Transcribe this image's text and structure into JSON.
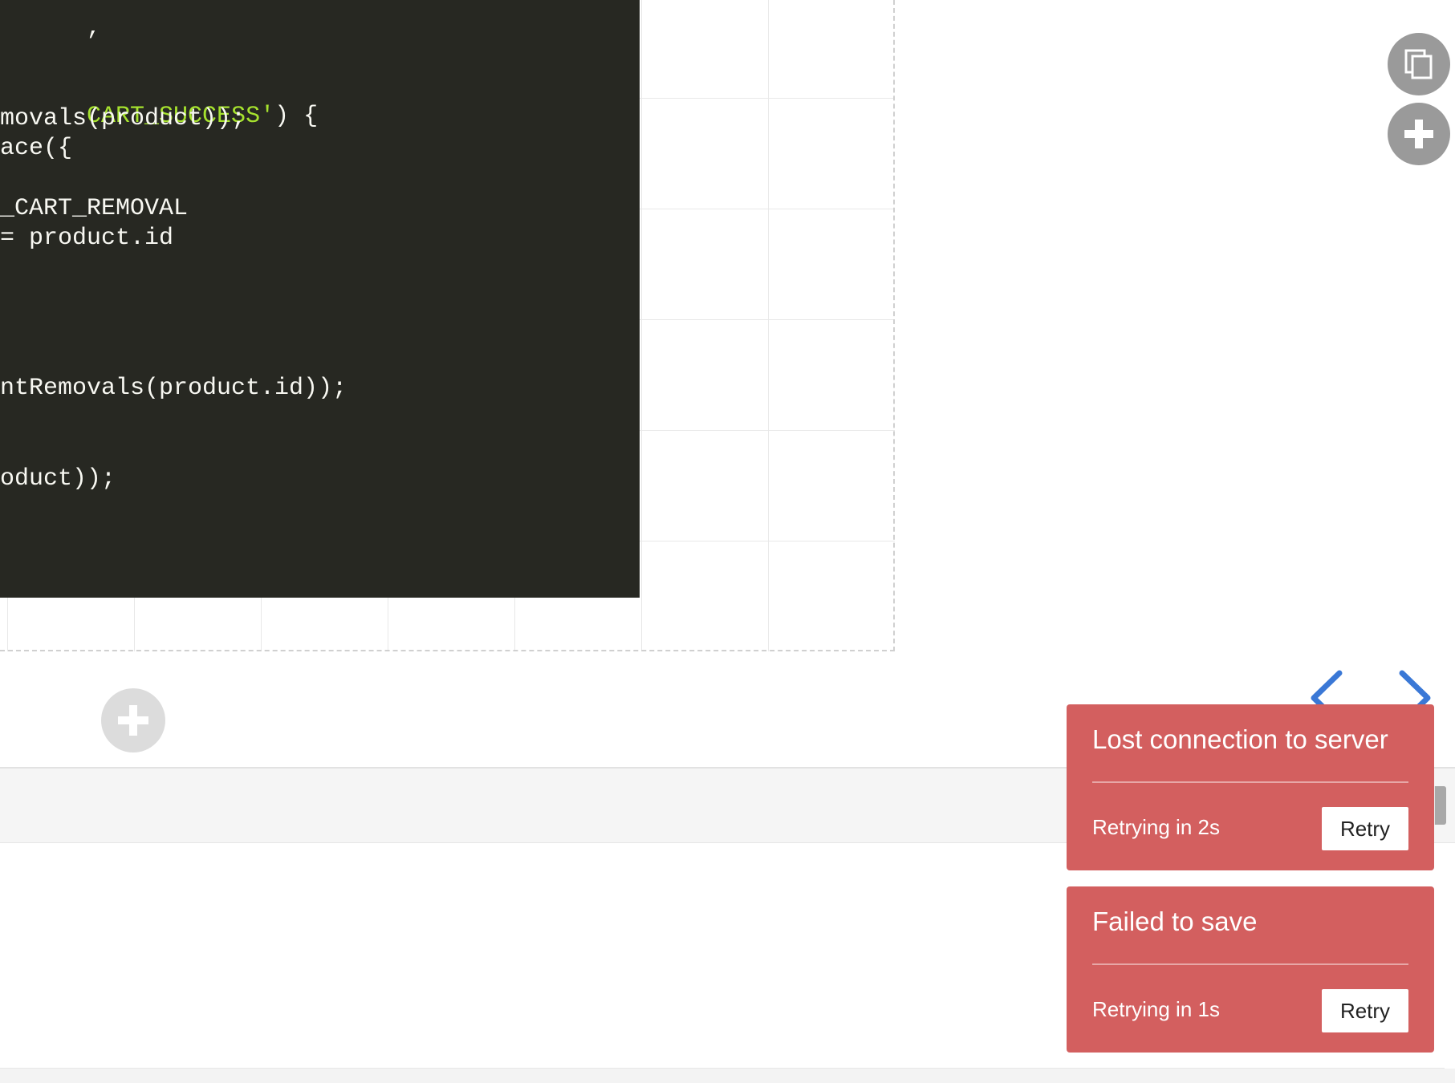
{
  "code_editor": {
    "lines": [
      {
        "plain": ",",
        "str": ""
      },
      {
        "plain": "",
        "str": "CART_SUCCESS'",
        "after": ") {"
      },
      {
        "plain": "movals(product));",
        "str": ""
      },
      {
        "plain": "ace({",
        "str": ""
      },
      {
        "plain": "_CART_REMOVAL",
        "str": ""
      },
      {
        "plain": "= product.id",
        "str": ""
      },
      {
        "plain": "ntRemovals(product.id));",
        "str": ""
      },
      {
        "plain": "oduct));",
        "str": ""
      }
    ],
    "colors": {
      "background": "#272822",
      "text": "#f8f8f2",
      "string": "#a6e22e"
    }
  },
  "tools": {
    "duplicate_icon": "copy-icon",
    "add_icon": "plus-icon",
    "add_row_icon": "plus-icon"
  },
  "navigation": {
    "prev_icon": "chevron-left-icon",
    "next_icon": "chevron-right-icon",
    "color": "#3a78d6"
  },
  "notifications": [
    {
      "title": "Lost connection to server",
      "status": "Retrying in 2s",
      "action": "Retry"
    },
    {
      "title": "Failed to save",
      "status": "Retrying in 1s",
      "action": "Retry"
    }
  ],
  "theme": {
    "toast_background": "#d35f5f",
    "tool_button": "#9a9a9a",
    "add_row_button": "#dcdcdc"
  }
}
